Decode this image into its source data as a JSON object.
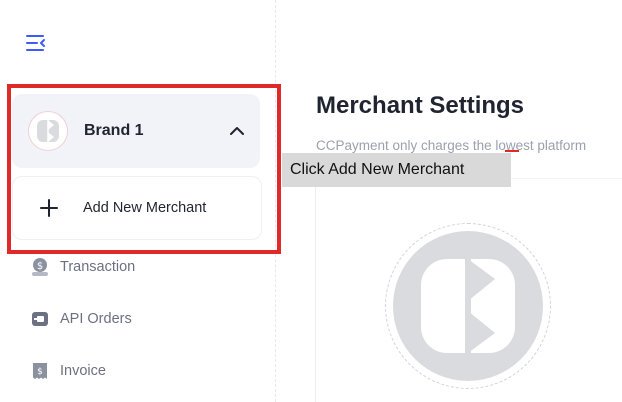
{
  "sidebar": {
    "brand": {
      "name": "Brand 1"
    },
    "add_merchant": {
      "label": "Add New Merchant"
    },
    "nav": [
      {
        "label": "Transaction",
        "icon": "transaction-icon"
      },
      {
        "label": "API Orders",
        "icon": "api-orders-icon"
      },
      {
        "label": "Invoice",
        "icon": "invoice-icon"
      }
    ]
  },
  "main": {
    "title": "Merchant Settings",
    "subtitle": "CCPayment only charges the lowest platform"
  },
  "tooltip": {
    "text": "Click Add New Merchant"
  },
  "colors": {
    "accent": "#3b5bfd",
    "highlight": "#e02a2a",
    "brand_card_bg": "#f1f3f8"
  }
}
